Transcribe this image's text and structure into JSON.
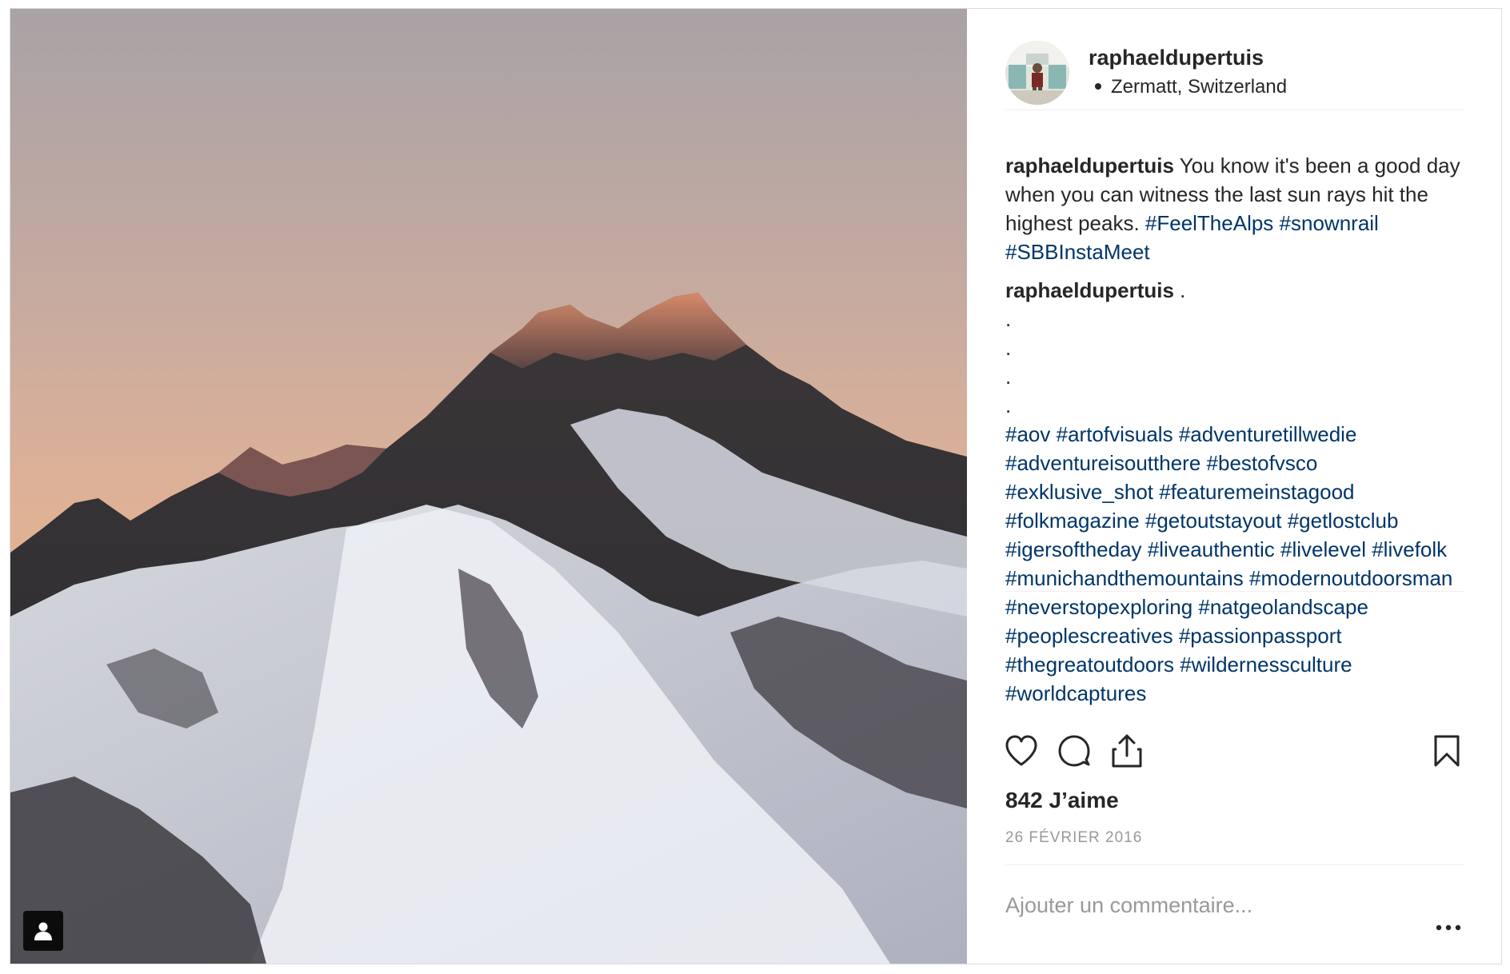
{
  "post": {
    "username": "raphaeldupertuis",
    "location": "Zermatt, Switzerland"
  },
  "caption": {
    "username": "raphaeldupertuis",
    "text": " You know it's been a good day when you can witness the last sun rays hit the highest peaks. ",
    "hashtags": [
      "#FeelTheAlps",
      "#snownrail",
      "#SBBInstaMeet"
    ]
  },
  "comment": {
    "username": "raphaeldupertuis",
    "text": " .",
    "dots": [
      ".",
      ".",
      ".",
      "."
    ],
    "hashtags": [
      "#aov",
      "#artofvisuals",
      "#adventuretillwedie",
      "#adventureisoutthere",
      "#bestofvsco",
      "#exklusive_shot",
      "#featuremeinstagood",
      "#folkmagazine",
      "#getoutstayout",
      "#getlostclub",
      "#igersoftheday",
      "#liveauthentic",
      "#livelevel",
      "#livefolk",
      "#munichandthemountains",
      "#modernoutdoorsman",
      "#neverstopexploring",
      "#natgeolandscape",
      "#peoplescreatives",
      "#passionpassport",
      "#thegreatoutdoors",
      "#wildernessculture",
      "#worldcaptures"
    ]
  },
  "actions": {
    "like_icon": "heart-icon",
    "comment_icon": "speech-bubble-icon",
    "share_icon": "share-icon",
    "save_icon": "bookmark-icon"
  },
  "likes": "842 J’aime",
  "date": "26 FÉVRIER 2016",
  "add_comment": {
    "placeholder": "Ajouter un commentaire...",
    "value": ""
  },
  "more_icon": "ellipsis-icon",
  "tag_badge_icon": "person-icon",
  "colors": {
    "text": "#262626",
    "hashtag": "#003569",
    "muted": "#999999",
    "border": "#dbdbdb"
  }
}
